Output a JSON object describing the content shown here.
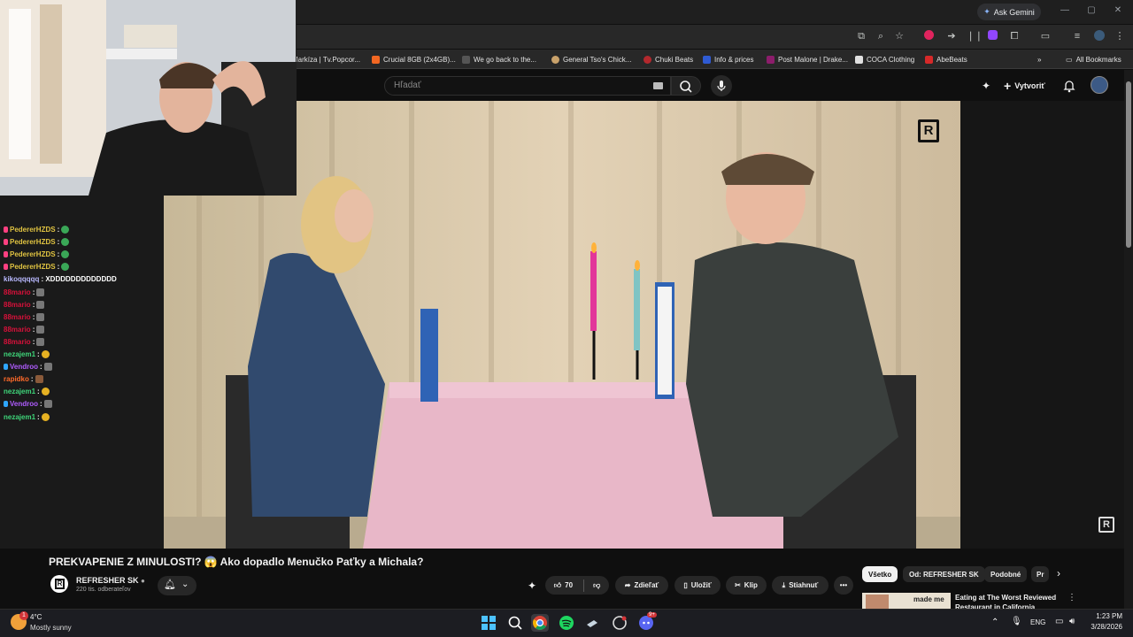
{
  "browser": {
    "ask_gemini": "Ask Gemini",
    "bookmarks": [
      {
        "label": "Markíza | Tv.Popcor...",
        "color": "#e2001a"
      },
      {
        "label": "Crucial 8GB (2x4GB)...",
        "color": "#f26722"
      },
      {
        "label": "We go back to the...",
        "color": "#555555"
      },
      {
        "label": "General Tso's Chick...",
        "color": "#c9a26b"
      },
      {
        "label": "Chuki Beats",
        "color": "#b3282d"
      },
      {
        "label": "Info & prices",
        "color": "#2f5bd3"
      },
      {
        "label": "Post Malone | Drake...",
        "color": "#8c1d6b"
      },
      {
        "label": "COCA Clothing",
        "color": "#e0e0e0"
      },
      {
        "label": "AbeBeats",
        "color": "#d62929"
      }
    ],
    "all_bookmarks": "All Bookmarks"
  },
  "youtube": {
    "search_placeholder": "Hľadať",
    "create_label": "Vytvoriť",
    "video_title": "PREKVAPENIE Z MINULOSTI? 😱 Ako dopadlo Menučko Paťky a Michala?",
    "channel_name": "REFRESHER SK",
    "subscribers": "220 tis. odberateľov",
    "likes": "70",
    "share_label": "Zdieľať",
    "save_label": "Uložiť",
    "clip_label": "Klip",
    "download_label": "Stiahnuť",
    "chips": [
      "Všetko",
      "Od: REFRESHER SK",
      "Podobné",
      "Pr"
    ],
    "recommended_title": "Eating at The Worst Reviewed Restaurant in California",
    "thumbnail_caption": "made me"
  },
  "chat": [
    {
      "user": "PedererHZDS",
      "msg": ":",
      "color": "#e0c341",
      "badge": "#ff4081"
    },
    {
      "user": "PedererHZDS",
      "msg": ":",
      "color": "#e0c341",
      "badge": "#ff4081"
    },
    {
      "user": "PedererHZDS",
      "msg": ":",
      "color": "#e0c341",
      "badge": "#ff4081"
    },
    {
      "user": "PedererHZDS",
      "msg": ":",
      "color": "#e0c341",
      "badge": "#ff4081"
    },
    {
      "user": "kikoqqqqq",
      "msg": ": XDDDDDDDDDDDDD",
      "color": "#b9b9ff",
      "badge": ""
    },
    {
      "user": "88mario",
      "msg": ":",
      "color": "#d6113a",
      "badge": ""
    },
    {
      "user": "88mario",
      "msg": ":",
      "color": "#d6113a",
      "badge": ""
    },
    {
      "user": "88mario",
      "msg": ":",
      "color": "#d6113a",
      "badge": ""
    },
    {
      "user": "88mario",
      "msg": ":",
      "color": "#d6113a",
      "badge": ""
    },
    {
      "user": "88mario",
      "msg": ":",
      "color": "#d6113a",
      "badge": ""
    },
    {
      "user": "nezajem1",
      "msg": ":",
      "color": "#3fd67a",
      "badge": ""
    },
    {
      "user": "Vendroo",
      "msg": ":",
      "color": "#b05cff",
      "badge": "#2fa7ff"
    },
    {
      "user": "rapidko",
      "msg": ":",
      "color": "#ff6a2a",
      "badge": ""
    },
    {
      "user": "nezajem1",
      "msg": ":",
      "color": "#3fd67a",
      "badge": ""
    },
    {
      "user": "Vendroo",
      "msg": ":",
      "color": "#b05cff",
      "badge": "#2fa7ff"
    },
    {
      "user": "nezajem1",
      "msg": ":",
      "color": "#3fd67a",
      "badge": ""
    }
  ],
  "taskbar": {
    "weather_temp": "4°C",
    "weather_desc": "Mostly sunny",
    "weather_badge": "1",
    "language": "ENG",
    "time": "1:23 PM",
    "date": "3/28/2026",
    "discord_badge": "9+"
  }
}
